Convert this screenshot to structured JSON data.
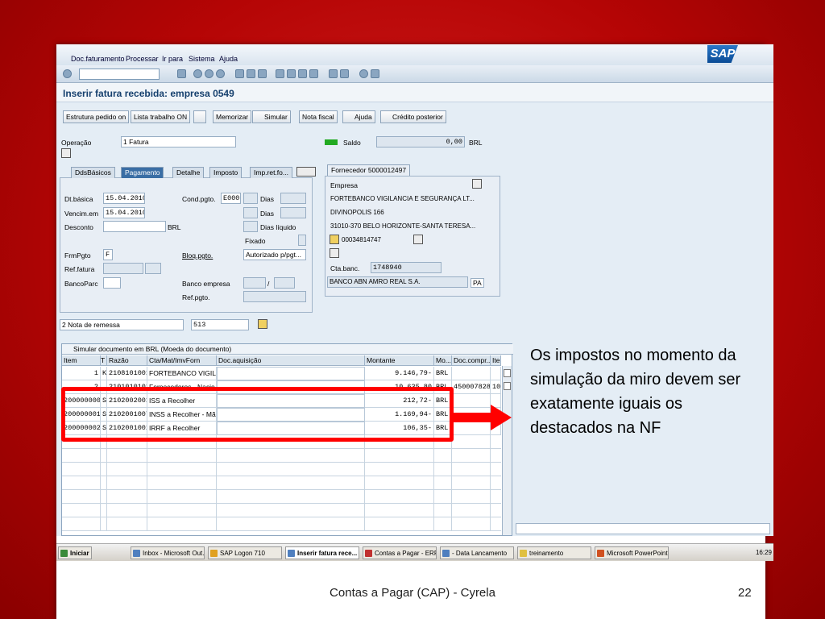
{
  "menu": [
    "Doc.faturamento",
    "Processar",
    "Ir para",
    "Sistema",
    "Ajuda"
  ],
  "title": "Inserir fatura recebida: empresa 0549",
  "buttons": [
    "Estrutura pedido on",
    "Lista trabalho ON",
    "Memorizar",
    "Simular",
    "Nota fiscal",
    "Ajuda",
    "Crédito posterior"
  ],
  "header": {
    "operacao_label": "Operação",
    "operacao_value": "1 Fatura",
    "saldo_label": "Saldo",
    "saldo_value": "0,00",
    "currency": "BRL"
  },
  "tabs": [
    "DdsBásicos",
    "Pagamento",
    "Detalhe",
    "Imposto",
    "Imp.ret.fo..."
  ],
  "pagamento": {
    "dtbasica_label": "Dt.básica",
    "dtbasica_value": "15.04.2010",
    "vencim_label": "Vencim.em",
    "vencim_value": "15.04.2010",
    "desconto_label": "Desconto",
    "desconto_cur": "BRL",
    "condpgto_label": "Cond.pgto.",
    "condpgto_value": "E000",
    "dias1": "Dias",
    "dias2": "Dias",
    "diasliq": "Dias líquido",
    "fixado": "Fixado",
    "frmpgto_label": "FrmPgto",
    "frmpgto_value": "F",
    "bloq_label": "Bloq.pgto.",
    "bloq_value": "Autorizado p/pgt...",
    "reffatura_label": "Ref.fatura",
    "bancoparc_label": "BancoParc",
    "bancoemp_label": "Banco empresa",
    "slash": "/",
    "refpgto_label": "Ref.pgto."
  },
  "fornecedor": {
    "tab": "Fornecedor 5000012497",
    "empresa": "Empresa",
    "line1": "FORTEBANCO VIGILANCIA E SEGURANÇA LT...",
    "line2": "DIVINOPOLIS 166",
    "line3": "31010-370 BELO HORIZONTE-SANTA TERESA...",
    "phone": "00034814747",
    "ctabanc_label": "Cta.banc.",
    "ctabanc_value": "1748940",
    "banco": "BANCO ABN AMRO REAL S.A.",
    "pa": "PA"
  },
  "remessa": {
    "value": "2 Nota de remessa",
    "num": "513"
  },
  "grid": {
    "title": "Simular documento em BRL (Moeda do documento)",
    "columns": [
      "Item",
      "T",
      "Razão",
      "Cta/Mat/ImvForn",
      "Doc.aquisição",
      "Montante",
      "Mo...",
      "Doc.compr...",
      "Ite"
    ],
    "rows": [
      {
        "item": "1",
        "t": "K",
        "razao": "2108101001",
        "cta": "FORTEBANCO VIGILA...",
        "doc": "",
        "montante": "9.146,79-",
        "moeda": "BRL",
        "doccompr": "",
        "ite": ""
      },
      {
        "item": "2",
        "t": "",
        "razao": "2101010101",
        "cta": "Fornecedores - Nacio...",
        "doc": "",
        "montante": "10.635,80",
        "moeda": "BRL",
        "doccompr": "4500078288",
        "ite": "10"
      },
      {
        "item": "200000000",
        "t": "S",
        "razao": "2102002001",
        "cta": "ISS a Recolher",
        "doc": "",
        "montante": "212,72-",
        "moeda": "BRL",
        "doccompr": "",
        "ite": ""
      },
      {
        "item": "200000001",
        "t": "S",
        "razao": "2102001007",
        "cta": "INSS a Recolher - Mão...",
        "doc": "",
        "montante": "1.169,94-",
        "moeda": "BRL",
        "doccompr": "",
        "ite": ""
      },
      {
        "item": "200000002",
        "t": "S",
        "razao": "2102001001",
        "cta": "IRRF a Recolher",
        "doc": "",
        "montante": "106,35-",
        "moeda": "BRL",
        "doccompr": "",
        "ite": ""
      }
    ]
  },
  "callout": "Os impostos no momento da simulação da miro devem ser exatamente iguais os destacados na NF",
  "taskbar": {
    "start": "Iniciar",
    "items": [
      "Inbox - Microsoft Out...",
      "SAP Logon 710",
      "Inserir fatura rece...",
      "Contas a Pagar - ERP...",
      "- Data Lancamento",
      "treinamento",
      "Microsoft PowerPoint ..."
    ],
    "clock": "16:29"
  },
  "footer": "Contas a Pagar (CAP) - Cyrela",
  "page": "22",
  "sap_logo": "SAP"
}
